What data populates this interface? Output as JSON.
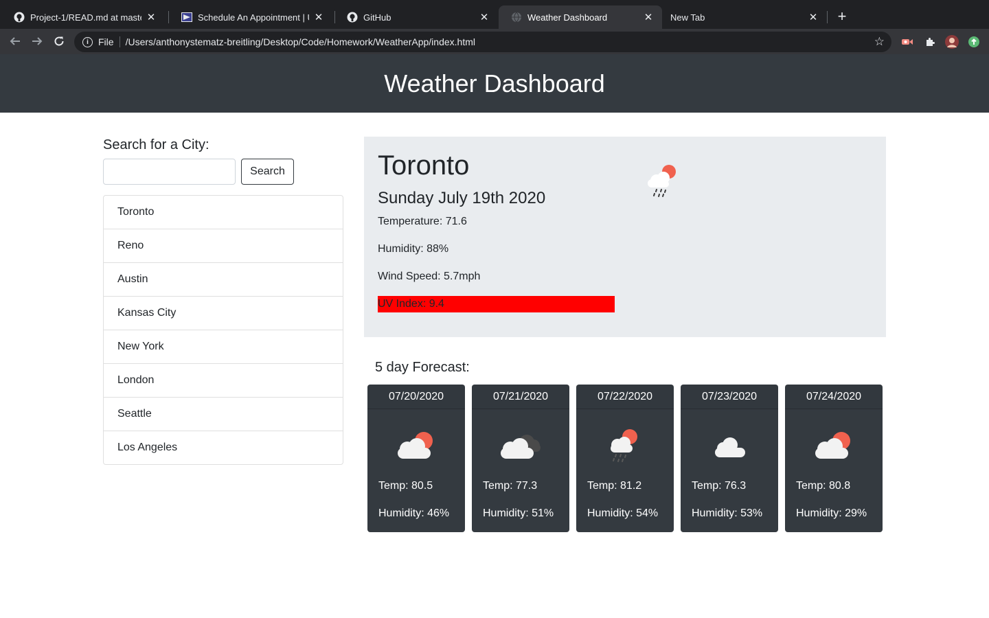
{
  "browser": {
    "tabs": [
      {
        "title": "Project-1/READ.md at master · ",
        "icon": "github-icon"
      },
      {
        "title": "Schedule An Appointment | US",
        "icon": "schedule-icon"
      },
      {
        "title": "GitHub",
        "icon": "github-icon"
      },
      {
        "title": "Weather Dashboard",
        "icon": "globe-icon"
      },
      {
        "title": "New Tab",
        "icon": ""
      }
    ],
    "address_scheme": "File",
    "address": "/Users/anthonystematz-breitling/Desktop/Code/Homework/WeatherApp/index.html"
  },
  "header": {
    "title": "Weather Dashboard"
  },
  "search": {
    "label": "Search for a City:",
    "input_value": "",
    "button_label": "Search"
  },
  "cities": [
    "Toronto",
    "Reno",
    "Austin",
    "Kansas City",
    "New York",
    "London",
    "Seattle",
    "Los Angeles"
  ],
  "current": {
    "city": "Toronto",
    "date": "Sunday July 19th 2020",
    "temperature": "Temperature: 71.6",
    "humidity": "Humidity: 88%",
    "wind": "Wind Speed: 5.7mph",
    "uv": "UV Index: 9.4",
    "uv_color": "#ff0000",
    "icon": "sun-cloud-rain-icon"
  },
  "forecast": {
    "title": "5 day Forecast:",
    "days": [
      {
        "date": "07/20/2020",
        "temp": "Temp: 80.5",
        "humidity": "Humidity: 46%",
        "icon": "sun-cloud-icon"
      },
      {
        "date": "07/21/2020",
        "temp": "Temp: 77.3",
        "humidity": "Humidity: 51%",
        "icon": "broken-clouds-icon"
      },
      {
        "date": "07/22/2020",
        "temp": "Temp: 81.2",
        "humidity": "Humidity: 54%",
        "icon": "sun-cloud-rain-icon"
      },
      {
        "date": "07/23/2020",
        "temp": "Temp: 76.3",
        "humidity": "Humidity: 53%",
        "icon": "cloud-icon"
      },
      {
        "date": "07/24/2020",
        "temp": "Temp: 80.8",
        "humidity": "Humidity: 29%",
        "icon": "sun-cloud-icon"
      }
    ]
  },
  "colors": {
    "header_bg": "#343a40",
    "current_bg": "#e9ecef",
    "card_bg": "#343a40",
    "sun": "#f0614e"
  }
}
